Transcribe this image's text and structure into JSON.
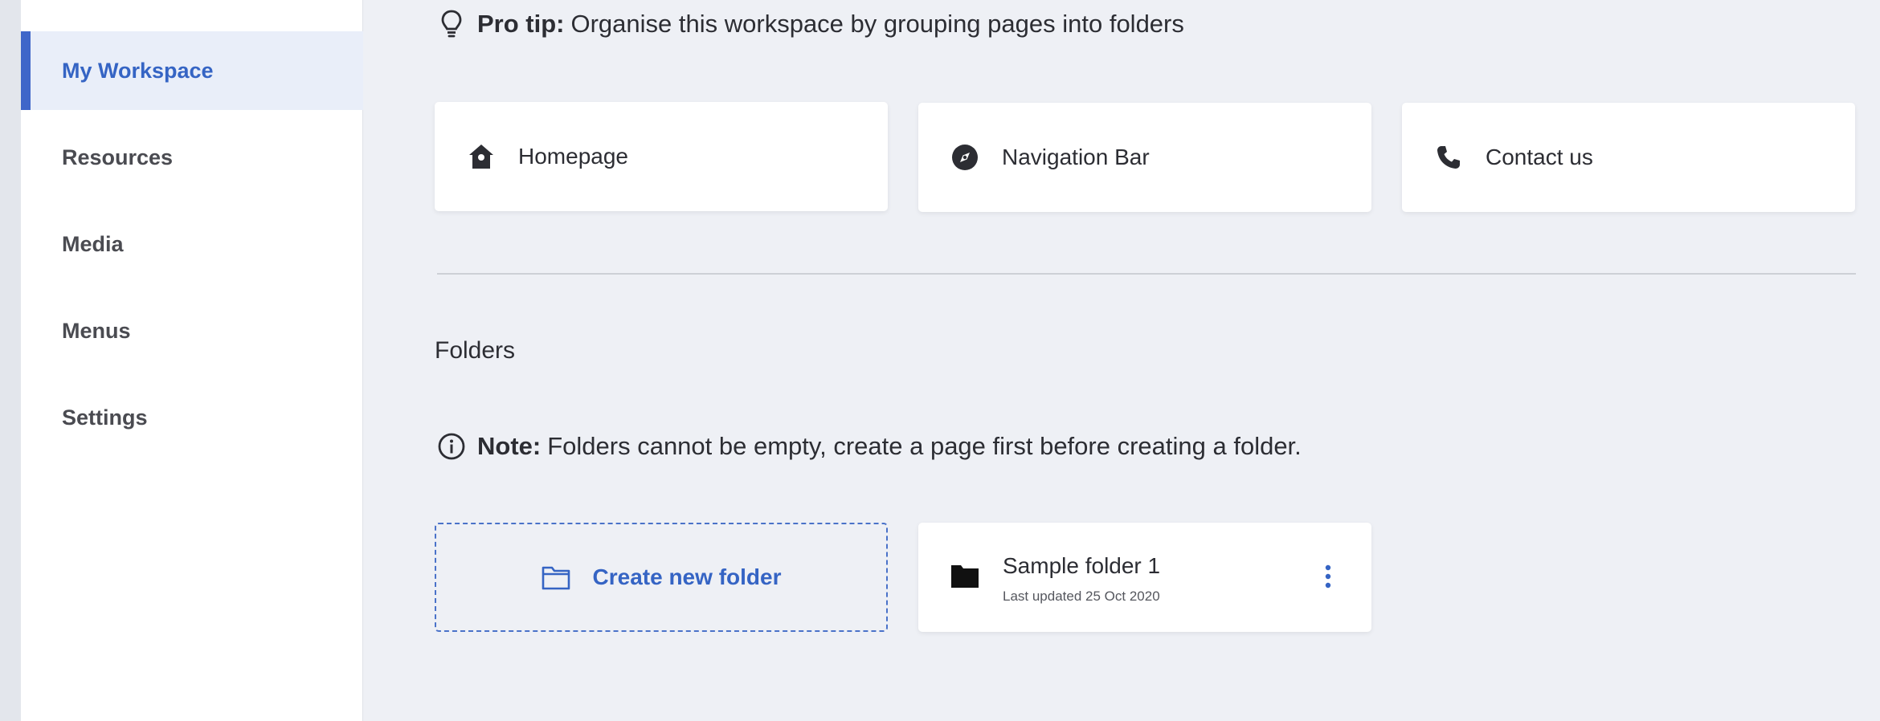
{
  "sidebar": {
    "items": [
      {
        "label": "My Workspace",
        "active": true
      },
      {
        "label": "Resources"
      },
      {
        "label": "Media"
      },
      {
        "label": "Menus"
      },
      {
        "label": "Settings"
      }
    ]
  },
  "tip": {
    "icon": "lightbulb-icon",
    "bold": "Pro tip:",
    "text": "Organise this workspace by grouping pages into folders"
  },
  "pages": [
    {
      "label": "Homepage",
      "icon": "home-icon"
    },
    {
      "label": "Navigation Bar",
      "icon": "compass-icon"
    },
    {
      "label": "Contact us",
      "icon": "phone-icon"
    }
  ],
  "folders_section": {
    "title": "Folders",
    "note": {
      "icon": "info-icon",
      "bold": "Note:",
      "text": "Folders cannot be empty, create a page first before creating a folder."
    },
    "create_label": "Create new folder",
    "folders": [
      {
        "name": "Sample folder 1",
        "updated": "Last updated 25 Oct 2020"
      }
    ]
  },
  "colors": {
    "accent": "#3564c4",
    "background": "#eef0f5",
    "sidebar_active_bg": "#e9eef9"
  }
}
